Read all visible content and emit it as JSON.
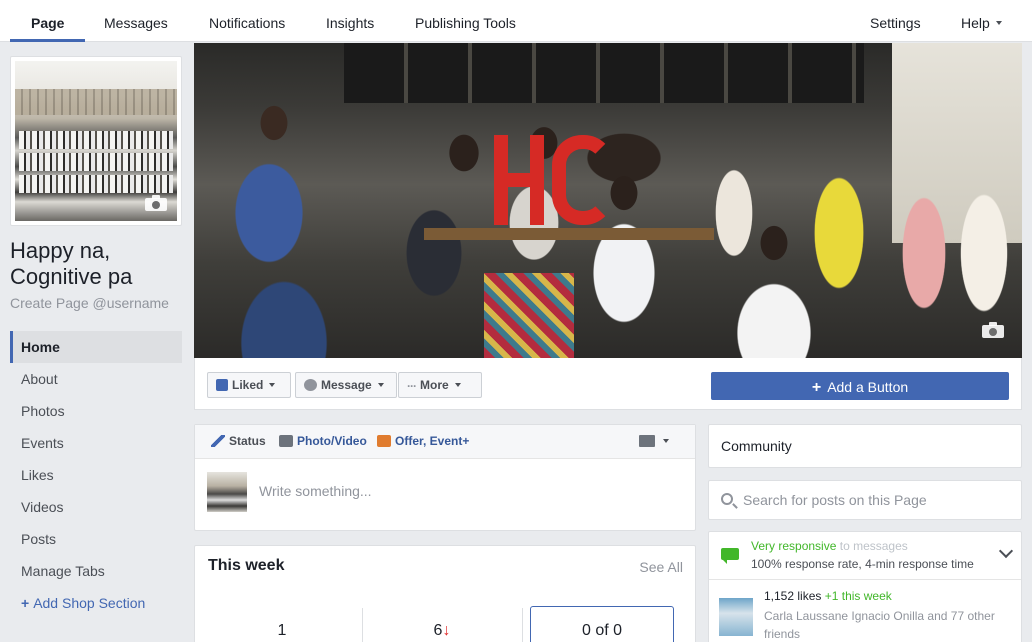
{
  "topnav": {
    "tabs": [
      "Page",
      "Messages",
      "Notifications",
      "Insights",
      "Publishing Tools"
    ],
    "settings": "Settings",
    "help": "Help"
  },
  "page": {
    "name": "Happy na, Cognitive pa",
    "username_link": "Create Page @username"
  },
  "leftnav": {
    "items": [
      "Home",
      "About",
      "Photos",
      "Events",
      "Likes",
      "Videos",
      "Posts",
      "Manage Tabs"
    ],
    "add_shop": "Add Shop Section"
  },
  "actions": {
    "liked": "Liked",
    "message": "Message",
    "more": "More",
    "add_button": "Add a Button"
  },
  "composer": {
    "status": "Status",
    "photo_video": "Photo/Video",
    "offer_event": "Offer, Event+",
    "placeholder": "Write something..."
  },
  "this_week": {
    "title": "This week",
    "see_all": "See All",
    "stats": [
      "1",
      "6",
      "0 of 0"
    ],
    "down_arrow": "↓"
  },
  "sidebar": {
    "community": "Community",
    "search_placeholder": "Search for posts on this Page",
    "responsive": "Very responsive",
    "responsive_suffix": "to messages",
    "response_detail": "100% response rate, 4-min response time",
    "likes_count": "1,152 likes",
    "likes_week": "+1 this week",
    "friends": "Carla Laussane Ignacio Onilla and 77 other friends"
  },
  "colors": {
    "accent": "#4267b2",
    "green": "#42b72a",
    "brand_red": "#d62a25"
  }
}
